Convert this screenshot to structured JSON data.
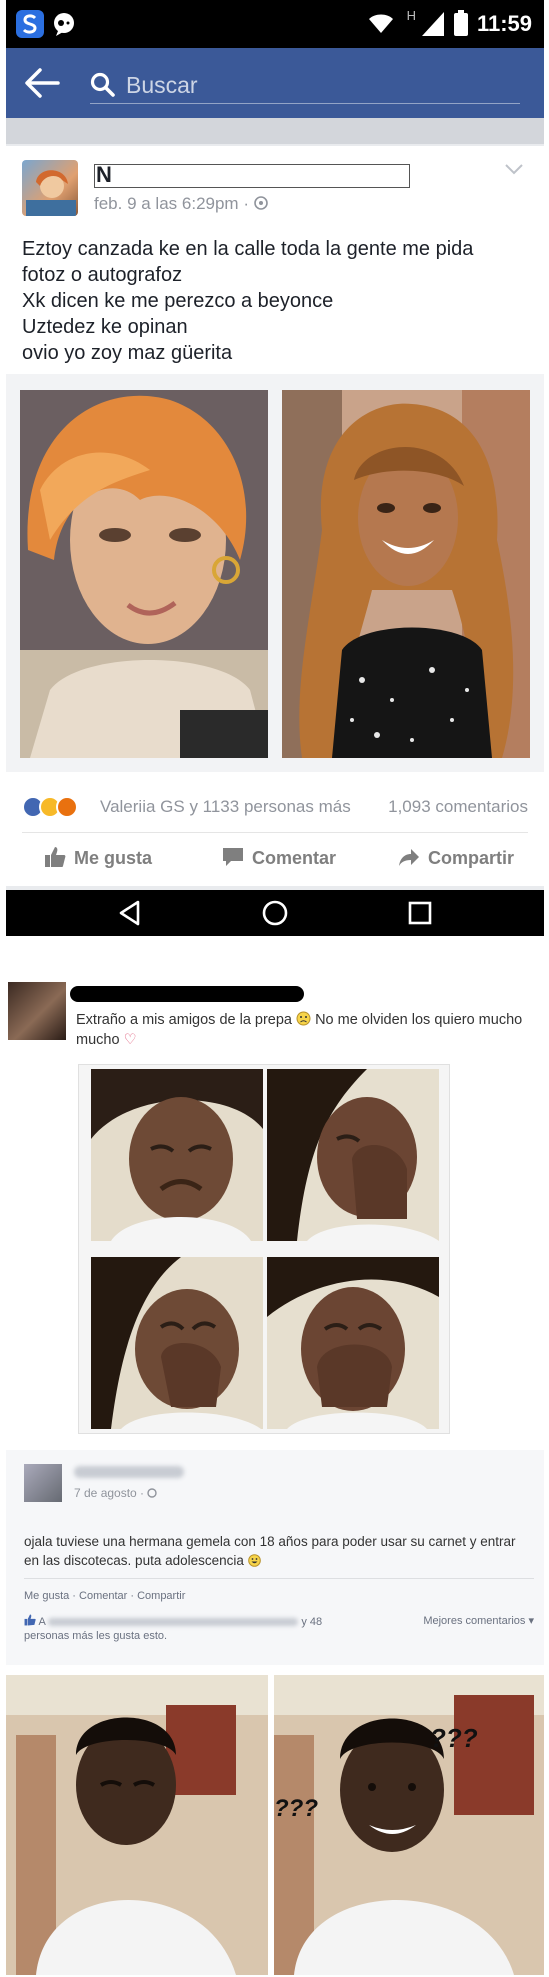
{
  "status_bar": {
    "time": "11:59",
    "signal_letter": "H"
  },
  "search": {
    "placeholder": "Buscar"
  },
  "post1": {
    "author_initial": "N",
    "meta": "feb. 9 a las 6:29pm ·",
    "lines": [
      "Eztoy canzada ke en la calle toda la gente me pida",
      "fotoz o autografoz",
      "Xk dicen ke me perezco a beyonce",
      "Uztedez ke opinan",
      "ovio yo zoy maz güerita"
    ],
    "reactions_text": "Valeriia GS y 1133 personas más",
    "comments_count": "1,093 comentarios",
    "actions": {
      "like": "Me gusta",
      "comment": "Comentar",
      "share": "Compartir"
    },
    "colors": {
      "brand": "#3b5998",
      "like": "#4267b2",
      "haha": "#f7b928",
      "angry": "#e9710f"
    }
  },
  "post2": {
    "line1": "Extraño a mis amigos de la prepa",
    "line1b": "No me olviden los quiero mucho",
    "line2": "mucho",
    "heart": "♡"
  },
  "post3": {
    "date": "7 de agosto ·",
    "text": "ojala tuviese una hermana gemela con 18 años para poder usar su carnet y entrar en las discotecas. puta adolescencia",
    "actions": "Me gusta · Comentar · Compartir",
    "likes_prefix": "A",
    "likes_count": "y 48",
    "likes_suffix": "personas más les gusta esto.",
    "best_comments": "Mejores comentarios ▾"
  },
  "meme": {
    "question_marks": "???"
  }
}
